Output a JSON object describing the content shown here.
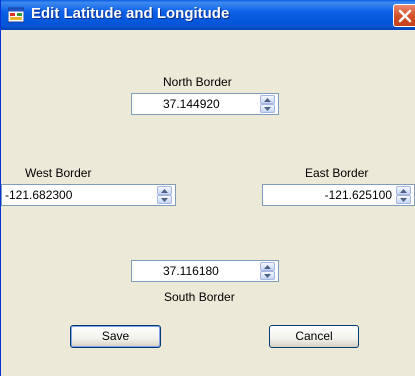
{
  "window": {
    "title": "Edit Latitude and  Longitude",
    "icons": {
      "app": "app-window-icon",
      "close": "close-icon"
    }
  },
  "north": {
    "label": "North Border",
    "value": "37.144920"
  },
  "west": {
    "label": "West Border",
    "value": "-121.682300"
  },
  "east": {
    "label": "East Border",
    "value": "-121.625100"
  },
  "south": {
    "label": "South Border",
    "value": "37.116180"
  },
  "buttons": {
    "save": "Save",
    "cancel": "Cancel"
  },
  "colors": {
    "titlebar": "#0355d6",
    "close": "#d34e23",
    "background": "#ece9d8"
  }
}
